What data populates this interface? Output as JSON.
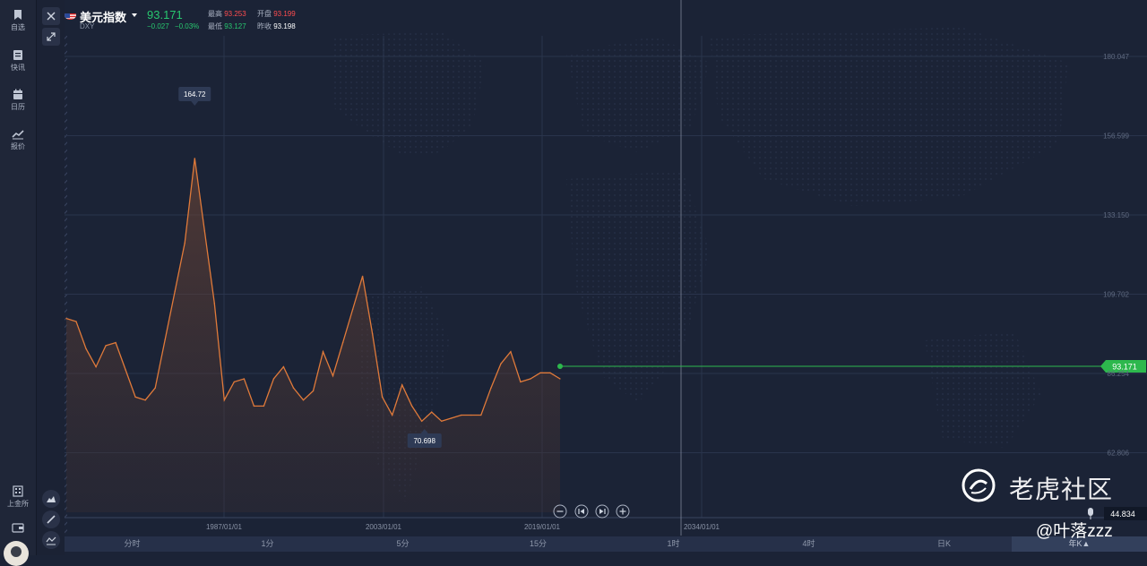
{
  "sidebar": {
    "items": [
      {
        "label": "自选",
        "icon": "bookmark-icon"
      },
      {
        "label": "快讯",
        "icon": "news-icon"
      },
      {
        "label": "日历",
        "icon": "calendar-icon"
      },
      {
        "label": "报价",
        "icon": "trend-icon"
      }
    ],
    "bottom_label": "上金所"
  },
  "header": {
    "name": "美元指数",
    "code": "DXY",
    "price": "93.171",
    "change": "−0.027",
    "change_pct": "−0.03%",
    "high_label": "最高",
    "high": "93.253",
    "open_label": "开盘",
    "open": "93.199",
    "low_label": "最低",
    "low": "93.127",
    "prev_label": "昨收",
    "prev": "93.198"
  },
  "chart": {
    "y_ticks": [
      "180.047",
      "156.599",
      "133.150",
      "109.702",
      "86.254",
      "62.806"
    ],
    "x_ticks": [
      "1987/01/01",
      "2003/01/01",
      "2019/01/01",
      "2034/01/01"
    ],
    "max_label": "164.72",
    "min_label": "70.698",
    "current_tag": "93.171",
    "crosshair_value": "44.834",
    "colors": {
      "line": "#e07a3a",
      "current": "#2db84d",
      "background": "#1b2336"
    }
  },
  "chart_data": {
    "type": "area",
    "ylim": [
      44.834,
      190
    ],
    "current_price": 93.171,
    "max_value": 164.72,
    "min_value": 70.698,
    "series": [
      {
        "values": [
          109,
          108,
          99,
          93,
          100,
          101,
          92,
          83,
          82,
          86,
          102,
          118,
          134,
          162,
          138,
          114,
          82,
          88,
          89,
          80,
          80,
          89,
          93,
          86,
          82,
          85,
          98,
          90,
          101,
          112,
          123,
          104,
          83,
          77,
          87,
          80,
          75,
          78,
          75,
          76,
          77,
          77,
          77,
          86,
          94,
          98,
          88,
          89,
          91,
          91,
          89
        ]
      }
    ]
  },
  "periods": [
    "分时",
    "1分",
    "5分",
    "15分",
    "1时",
    "4时",
    "日K",
    "年K▲"
  ],
  "watermark": {
    "text": "老虎社区",
    "user": "@叶落zzz"
  }
}
